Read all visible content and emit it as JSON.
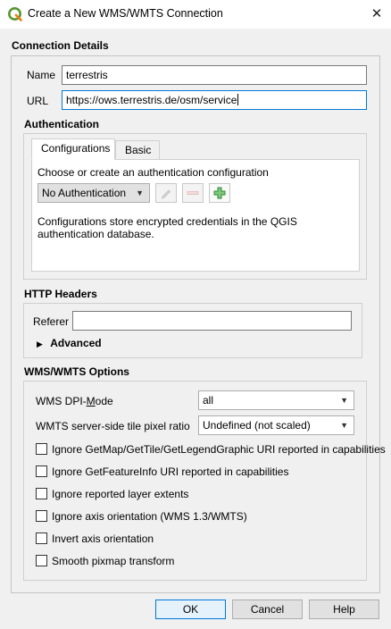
{
  "window": {
    "title": "Create a New WMS/WMTS Connection",
    "close_glyph": "✕"
  },
  "connection": {
    "heading": "Connection Details",
    "name_label": "Name",
    "name_value": "terrestris",
    "url_label": "URL",
    "url_value": "https://ows.terrestris.de/osm/service"
  },
  "auth": {
    "heading": "Authentication",
    "tabs": [
      {
        "label": "Configurations",
        "active": true
      },
      {
        "label": "Basic",
        "active": false
      }
    ],
    "prompt": "Choose or create an authentication configuration",
    "selected_config": "No Authentication",
    "note": "Configurations store encrypted credentials in the QGIS authentication database."
  },
  "http": {
    "heading": "HTTP Headers",
    "referer_label": "Referer",
    "referer_value": "",
    "advanced_label": "Advanced"
  },
  "wms": {
    "heading": "WMS/WMTS Options",
    "dpi_label": "WMS DPI-Mode",
    "dpi_value": "all",
    "pixel_ratio_label": "WMTS server-side tile pixel ratio",
    "pixel_ratio_value": "Undefined (not scaled)",
    "checkboxes": [
      {
        "label": "Ignore GetMap/GetTile/GetLegendGraphic URI reported in capabilities",
        "checked": false
      },
      {
        "label": "Ignore GetFeatureInfo URI reported in capabilities",
        "checked": false
      },
      {
        "label": "Ignore reported layer extents",
        "checked": false
      },
      {
        "label": "Ignore axis orientation (WMS 1.3/WMTS)",
        "checked": false
      },
      {
        "label": "Invert axis orientation",
        "checked": false
      },
      {
        "label": "Smooth pixmap transform",
        "checked": false
      }
    ]
  },
  "buttons": {
    "ok": "OK",
    "cancel": "Cancel",
    "help": "Help"
  },
  "icons": {
    "app": "qgis-logo-icon",
    "edit": "pencil-icon",
    "remove": "remove-icon",
    "add": "add-icon",
    "expander": "triangle-right-icon",
    "dropdown": "chevron-down-icon"
  },
  "colors": {
    "focus_border": "#0078d7",
    "default_button_bg": "#e5f1fb",
    "add_icon_green": "#2e8b2e",
    "logo_green": "#589632"
  }
}
